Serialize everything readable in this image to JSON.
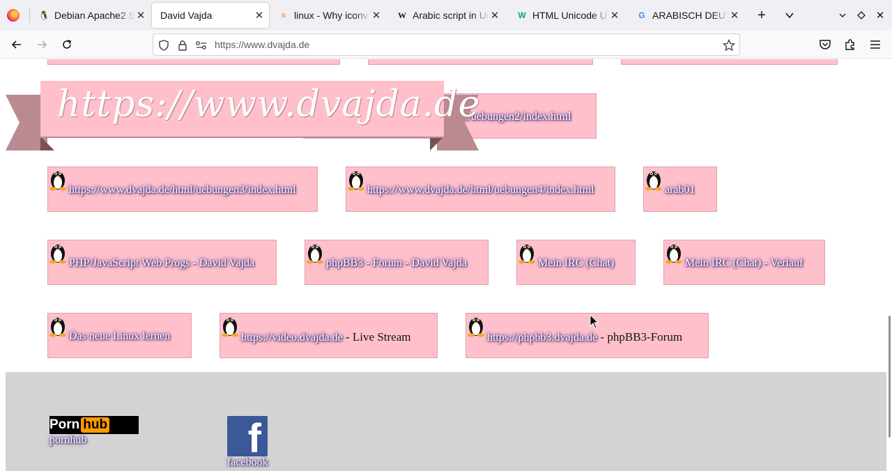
{
  "tabs": [
    {
      "label": "Debian Apache2 S",
      "favicon": "tux-icon"
    },
    {
      "label": "David Vajda",
      "favicon": ""
    },
    {
      "label": "linux - Why iconv c",
      "favicon": "stack-icon"
    },
    {
      "label": "Arabic script in Uni",
      "favicon": "W"
    },
    {
      "label": "HTML Unicode UTF",
      "favicon": "W"
    },
    {
      "label": "ARABISCH DEUTSC",
      "favicon": "G"
    }
  ],
  "url": "https://www.dvajda.de",
  "banner": "https://www.dvajda.de",
  "partial_link": "l/uebungen2/index.html",
  "links": {
    "r1": [
      "https://www.dvajda.de/html/uebungen3/index.html",
      "https://www.dvajda.de/html/uebungen4/index.html",
      "arab01"
    ],
    "r2": [
      "PHP/JavaScript Web Progs - David Vajda",
      "phpBB3 - Forum - David Vajda",
      "Mein IRC (Chat)",
      "Mein IRC (Chat) - Verlauf"
    ],
    "r3": [
      {
        "link": "Das neue Linux lernen",
        "suffix": ""
      },
      {
        "link": "https://video.dvajda.de",
        "suffix": " - Live Stream"
      },
      {
        "link": "https://phpbb3.dvajda.de",
        "suffix": " - phpBB3-Forum"
      }
    ]
  },
  "footer": {
    "pornhub_logo": {
      "porn": "Porn",
      "hub": "hub"
    },
    "pornhub_label": "pornhub",
    "facebook_logo": "f",
    "facebook_label": "facebook"
  },
  "colors": {
    "box": "#ffc0cb",
    "footer": "#d3d3d3"
  }
}
